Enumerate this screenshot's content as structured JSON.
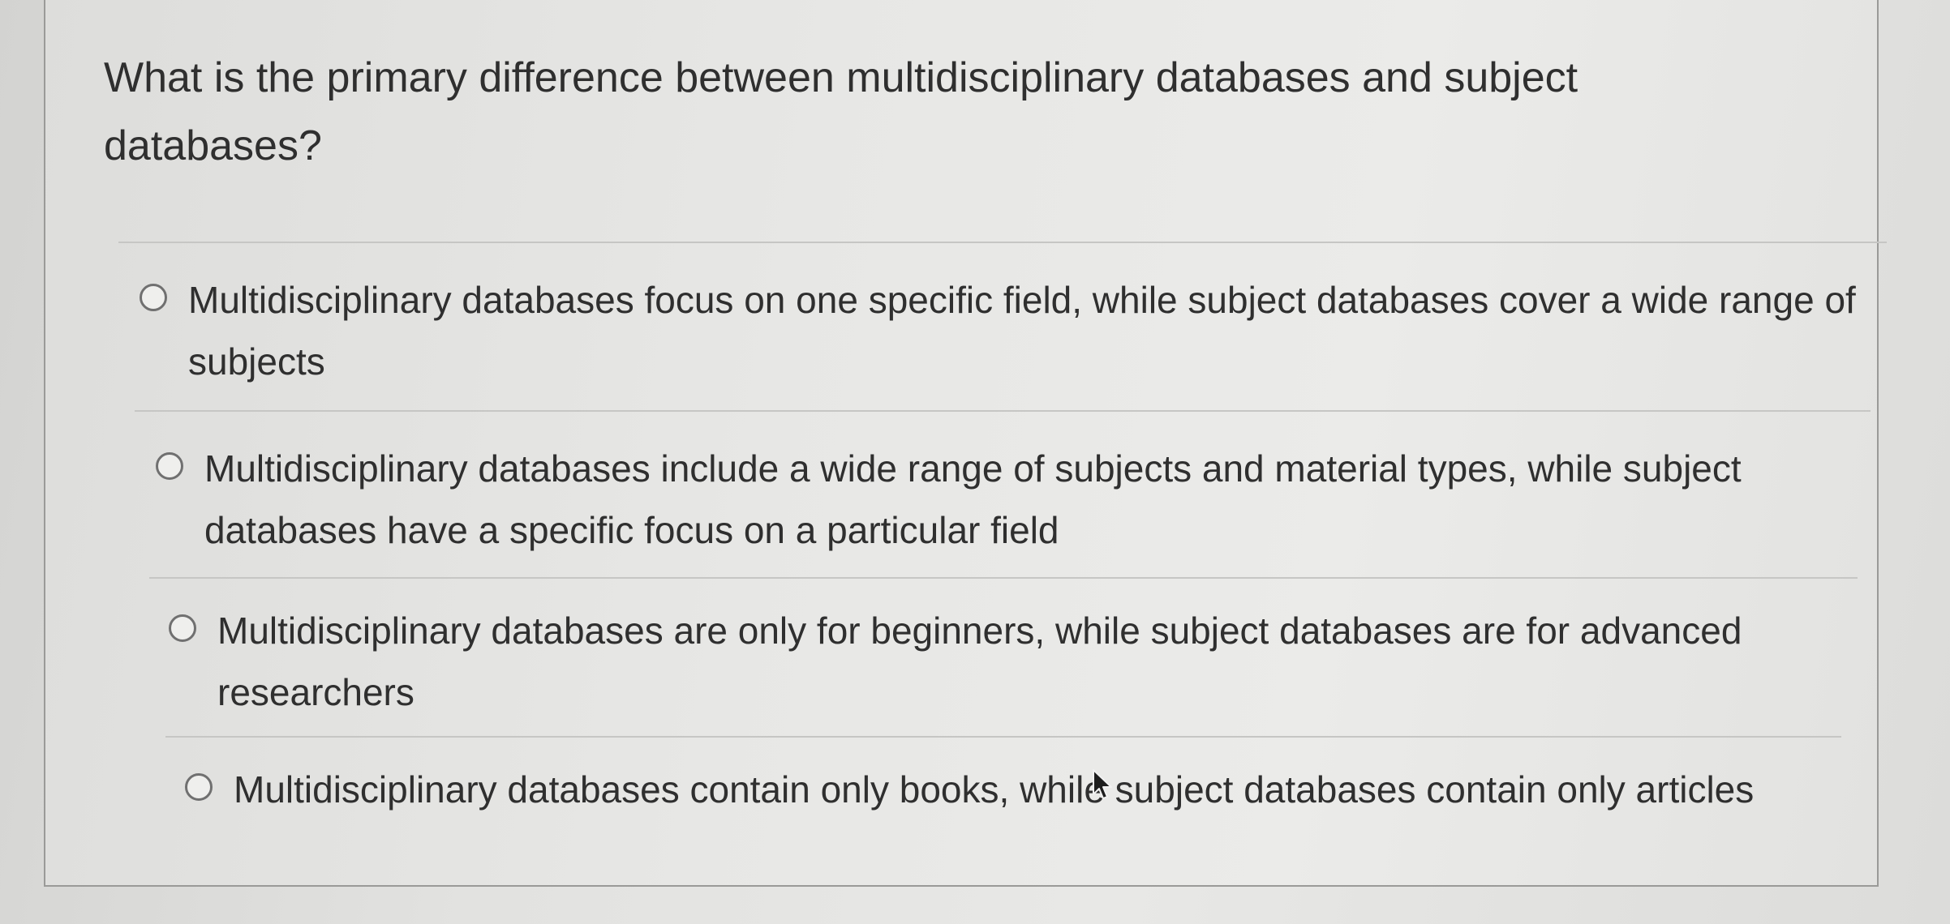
{
  "question": {
    "text": "What is the primary difference between multidisciplinary databases and subject databases?"
  },
  "options": [
    {
      "label": "Multidisciplinary databases focus on one specific field, while subject databases cover a wide range of subjects",
      "selected": false
    },
    {
      "label": "Multidisciplinary databases include a wide range of subjects and material types, while subject databases have a specific focus on a particular field",
      "selected": false
    },
    {
      "label": "Multidisciplinary databases are only for beginners, while subject databases are for advanced researchers",
      "selected": false
    },
    {
      "label": "Multidisciplinary databases contain only books, while subject databases contain only articles",
      "selected": false
    }
  ],
  "icons": {
    "radio": "radio-unchecked-icon",
    "cursor": "mouse-pointer-icon"
  },
  "colors": {
    "text": "#2f2f2f",
    "radio_border": "#707070",
    "divider": "#c6c6c4"
  }
}
